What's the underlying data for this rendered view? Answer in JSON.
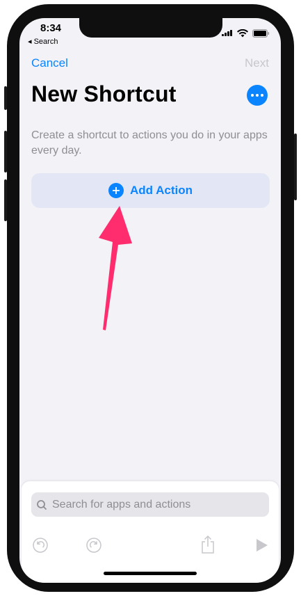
{
  "status_bar": {
    "time": "8:34",
    "back_label": "◂ Search"
  },
  "nav": {
    "cancel_label": "Cancel",
    "next_label": "Next"
  },
  "header": {
    "title": "New Shortcut",
    "more_icon": "ellipsis-icon"
  },
  "description": "Create a shortcut to actions you do in your apps every day.",
  "add_action": {
    "label": "Add Action",
    "icon": "plus-circle-icon"
  },
  "bottom_sheet": {
    "search_placeholder": "Search for apps and actions",
    "toolbar": [
      "undo-icon",
      "redo-icon",
      "share-icon",
      "play-icon"
    ]
  },
  "colors": {
    "accent": "#0a84ff",
    "disabled": "#c7c7cc",
    "secondary_text": "#8e8e93",
    "annotation_arrow": "#ff2d6e"
  }
}
